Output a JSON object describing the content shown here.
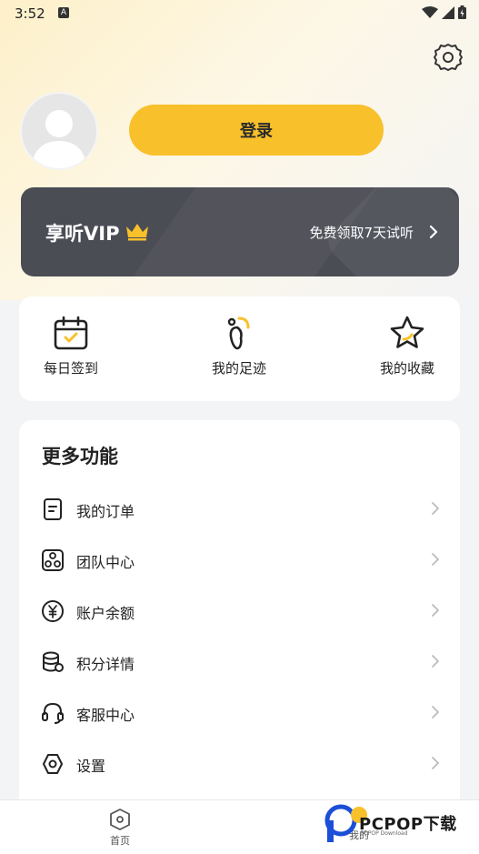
{
  "status_bar": {
    "time": "3:52",
    "notification_badge": "A"
  },
  "profile": {
    "login_label": "登录"
  },
  "vip": {
    "title": "享听VIP",
    "trial_text": "免费领取7天试听"
  },
  "quick_actions": [
    {
      "label": "每日签到",
      "icon": "calendar-check-icon"
    },
    {
      "label": "我的足迹",
      "icon": "footprint-icon"
    },
    {
      "label": "我的收藏",
      "icon": "star-icon"
    }
  ],
  "more": {
    "title": "更多功能",
    "items": [
      {
        "label": "我的订单",
        "icon": "order-icon"
      },
      {
        "label": "团队中心",
        "icon": "team-icon"
      },
      {
        "label": "账户余额",
        "icon": "yen-icon"
      },
      {
        "label": "积分详情",
        "icon": "points-icon"
      },
      {
        "label": "客服中心",
        "icon": "headset-icon"
      },
      {
        "label": "设置",
        "icon": "settings-icon"
      }
    ]
  },
  "tabs": [
    {
      "label": "首页",
      "icon": "home-icon"
    },
    {
      "label": "我的",
      "icon": "profile-icon"
    }
  ],
  "watermark": {
    "text": "PCPOP下载",
    "sub": "PCPOP Download"
  },
  "colors": {
    "accent": "#f8c02b",
    "vip_card": "#4b4d55",
    "background": "#f3f4f6"
  }
}
